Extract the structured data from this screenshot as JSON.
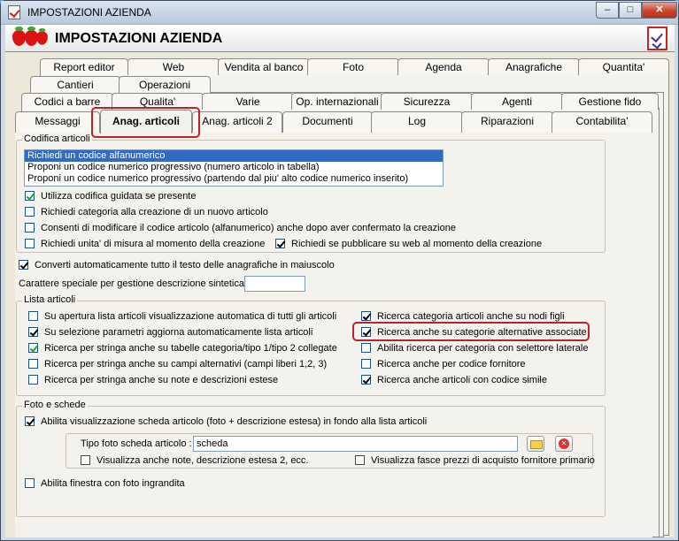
{
  "window": {
    "title": "IMPOSTAZIONI AZIENDA",
    "controls": {
      "minimize": "–",
      "maximize": "□",
      "close": "✕"
    }
  },
  "banner": {
    "title": "IMPOSTAZIONI AZIENDA"
  },
  "tabs": {
    "row1": [
      "Report editor",
      "Web",
      "Vendita al banco",
      "Foto",
      "Agenda",
      "Anagrafiche",
      "Quantita'"
    ],
    "row2": [
      "Cantieri",
      "Operazioni"
    ],
    "row3": [
      "Codici a barre",
      "Qualita'",
      "Varie",
      "Op. internazionali",
      "Sicurezza",
      "Agenti",
      "Gestione fido"
    ],
    "row4": [
      "Messaggi",
      "Anag. articoli",
      "Anag. articoli 2",
      "Documenti",
      "Log",
      "Riparazioni",
      "Contabilita'"
    ],
    "active": "Anag. articoli"
  },
  "codifica": {
    "title": "Codifica articoli",
    "options": [
      "Richiedi un codice alfanumerico",
      "Proponi un codice numerico progressivo (numero articolo in tabella)",
      "Proponi un codice numerico progressivo (partendo dal piu' alto codice numerico inserito)"
    ],
    "selected_index": 0,
    "checkboxes": [
      {
        "label": "Utilizza codifica guidata se presente",
        "checked": true
      },
      {
        "label": "Richiedi categoria alla creazione di un nuovo articolo",
        "checked": false
      },
      {
        "label": "Consenti di modificare il codice articolo (alfanumerico) anche dopo aver confermato la creazione",
        "checked": false
      },
      {
        "label": "Richiedi unita' di misura al momento della creazione",
        "checked": false
      },
      {
        "label": "Richiedi se pubblicare su web al momento della creazione",
        "checked": true
      }
    ]
  },
  "general": {
    "convert_upper": {
      "label": "Converti automaticamente tutto il testo delle anagrafiche in maiuscolo",
      "checked": true
    },
    "special_char_label": "Carattere speciale per gestione descrizione sintetica :",
    "special_char_value": ""
  },
  "lista": {
    "title": "Lista articoli",
    "left": [
      {
        "label": "Su apertura lista articoli visualizzazione automatica di tutti gli articoli",
        "checked": false
      },
      {
        "label": "Su selezione parametri aggiorna automaticamente lista articoli",
        "checked": true
      },
      {
        "label": "Ricerca per stringa anche su tabelle categoria/tipo 1/tipo 2 collegate",
        "checked": true
      },
      {
        "label": "Ricerca per stringa anche su campi alternativi (campi liberi 1,2, 3)",
        "checked": false
      },
      {
        "label": "Ricerca per stringa anche su note e descrizioni estese",
        "checked": false
      }
    ],
    "right": [
      {
        "label": "Ricerca categoria articoli anche su nodi figli",
        "checked": true
      },
      {
        "label": "Ricerca anche su categorie alternative associate",
        "checked": true
      },
      {
        "label": "Abilita ricerca per categoria con selettore laterale",
        "checked": false
      },
      {
        "label": "Ricerca anche per codice fornitore",
        "checked": false
      },
      {
        "label": "Ricerca anche articoli con codice simile",
        "checked": true
      }
    ]
  },
  "foto": {
    "title": "Foto e schede",
    "enable_scheda": {
      "label": "Abilita visualizzazione scheda articolo (foto + descrizione estesa) in fondo alla lista articoli",
      "checked": true
    },
    "tipo_label": "Tipo foto scheda articolo :",
    "tipo_value": "scheda",
    "note_cb": {
      "label": "Visualizza anche note, descrizione estesa 2, ecc.",
      "checked": false
    },
    "prezzi_cb": {
      "label": "Visualizza fasce prezzi di acquisto fornitore primario",
      "checked": false
    },
    "finestra_cb": {
      "label": "Abilita finestra con foto ingrandita",
      "checked": false
    }
  },
  "colors": {
    "highlight": "#c1202a",
    "selection": "#316ac5",
    "check": "#21a121"
  }
}
